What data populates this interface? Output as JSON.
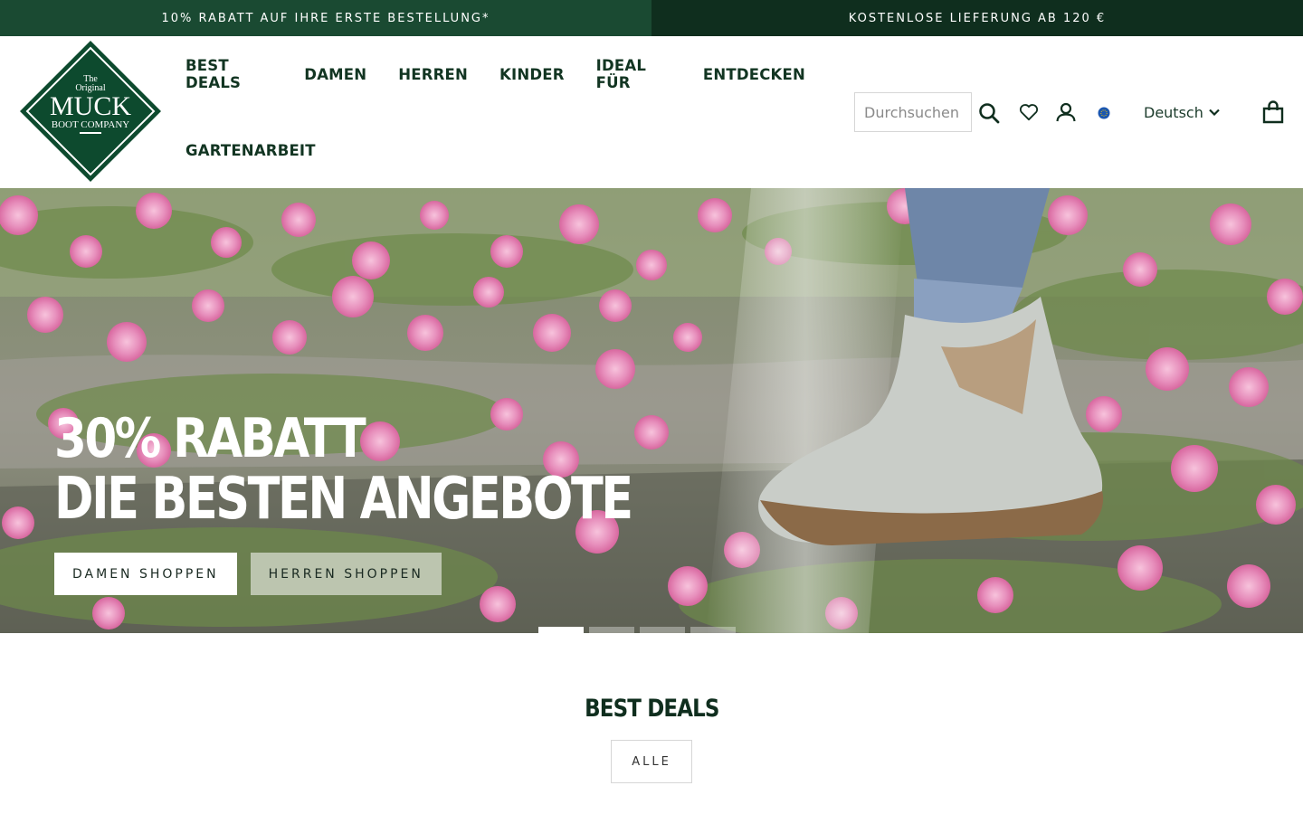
{
  "announcement": {
    "left": "10% RABATT AUF IHRE ERSTE BESTELLUNG*",
    "right": "KOSTENLOSE LIEFERUNG AB 120 €"
  },
  "logo": {
    "line1": "The",
    "line2": "Original",
    "line3": "MUCK",
    "line4": "BOOT COMPANY",
    "color": "#0d4a2e"
  },
  "nav": {
    "items": [
      "BEST DEALS",
      "DAMEN",
      "HERREN",
      "KINDER",
      "IDEAL FÜR",
      "ENTDECKEN",
      "GARTENARBEIT"
    ]
  },
  "search": {
    "placeholder": "Durchsuchen"
  },
  "icons": [
    "search-icon",
    "heart-icon",
    "account-icon",
    "globe-icon",
    "chevron-down-icon",
    "cart-icon"
  ],
  "language": {
    "selected": "Deutsch"
  },
  "hero": {
    "line1": "30% RABATT",
    "line2": "DIE BESTEN ANGEBOTE",
    "btn_women": "DAMEN SHOPPEN",
    "btn_men": "HERREN SHOPPEN",
    "slide_count": 4,
    "active_slide": 1
  },
  "best_deals": {
    "title": "BEST DEALS",
    "filter": "ALLE"
  },
  "colors": {
    "brand_green": "#1a4a32",
    "brand_dark": "#0f2e1e",
    "text": "#123522"
  }
}
